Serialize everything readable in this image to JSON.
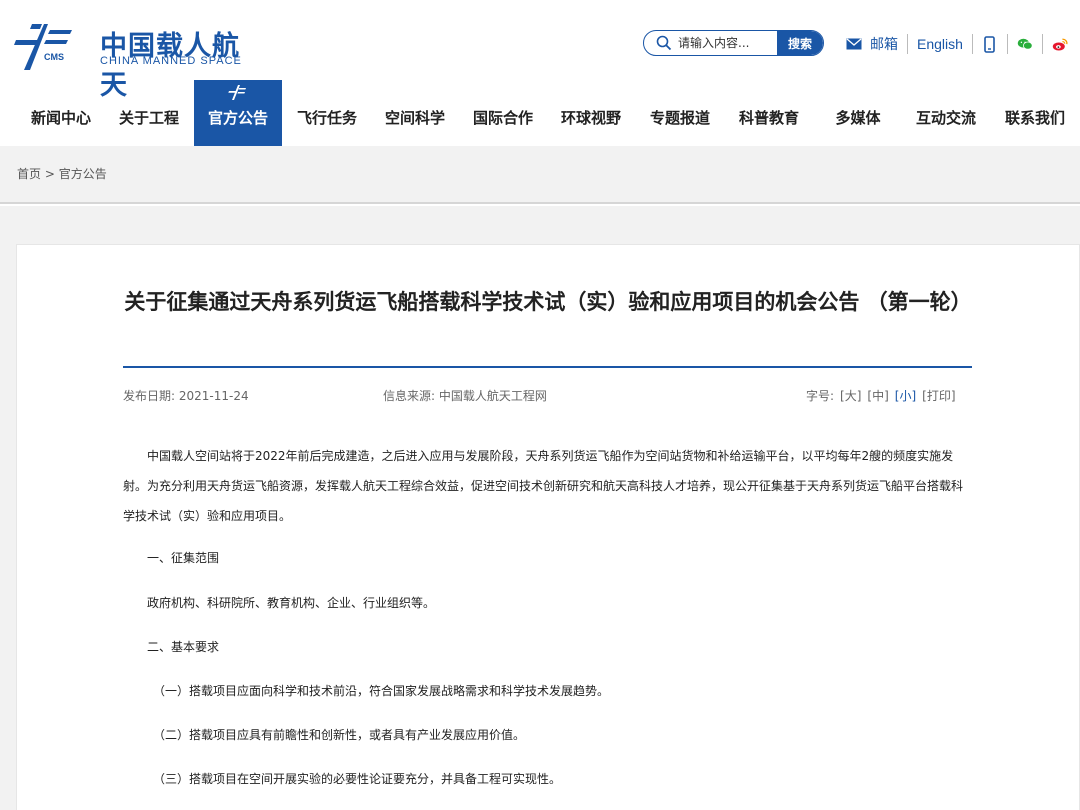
{
  "brand": {
    "name_cn": "中国载人航天",
    "name_en": "CHINA MANNED SPACE",
    "abbr": "CMS",
    "color": "#1a56a6"
  },
  "search": {
    "placeholder": "请输入内容...",
    "button": "搜索"
  },
  "top_links": {
    "mail": "邮箱",
    "english": "English",
    "icons": [
      "mobile-icon",
      "wechat-icon",
      "weibo-icon"
    ]
  },
  "nav": {
    "items": [
      {
        "label": "新闻中心",
        "active": false
      },
      {
        "label": "关于工程",
        "active": false
      },
      {
        "label": "官方公告",
        "active": true
      },
      {
        "label": "飞行任务",
        "active": false
      },
      {
        "label": "空间科学",
        "active": false
      },
      {
        "label": "国际合作",
        "active": false
      },
      {
        "label": "环球视野",
        "active": false
      },
      {
        "label": "专题报道",
        "active": false
      },
      {
        "label": "科普教育",
        "active": false
      },
      {
        "label": "多媒体",
        "active": false
      },
      {
        "label": "互动交流",
        "active": false
      },
      {
        "label": "联系我们",
        "active": false
      }
    ]
  },
  "breadcrumb": {
    "home": "首页",
    "separator": ">",
    "current": "官方公告"
  },
  "article": {
    "title": "关于征集通过天舟系列货运飞船搭载科学技术试（实）验和应用项目的机会公告 （第一轮）",
    "date": "发布日期: 2021-11-24",
    "source": "信息来源: 中国载人航天工程网",
    "font_size_label": "字号:",
    "size_options": [
      {
        "label": "[大]",
        "active": false
      },
      {
        "label": "[中]",
        "active": false
      },
      {
        "label": "[小]",
        "active": true
      },
      {
        "label": "[打印]",
        "active": false
      }
    ],
    "intro_line1": "中国载人空间站将于2022年前后完成建造，之后进入应用与发展阶段，天舟系列货运飞船作为空间站货物和补给运输平台，以平均每年2艘的频度实施发",
    "intro_line2": "射。为充分利用天舟货运飞船资源，发挥载人航天工程综合效益，促进空间技术创新研究和航天高科技人才培养，现公开征集基于天舟系列货运飞船平台搭载科",
    "intro_line3": "学技术试（实）验和应用项目。",
    "section1_heading": "一、征集范围",
    "section1_body": "政府机构、科研院所、教育机构、企业、行业组织等。",
    "section2_heading": "二、基本要求",
    "req1": "（一）搭载项目应面向科学和技术前沿，符合国家发展战略需求和科学技术发展趋势。",
    "req2": "（二）搭载项目应具有前瞻性和创新性，或者具有产业发展应用价值。",
    "req3": "（三）搭载项目在空间开展实验的必要性论证要充分，并具备工程可实现性。"
  }
}
